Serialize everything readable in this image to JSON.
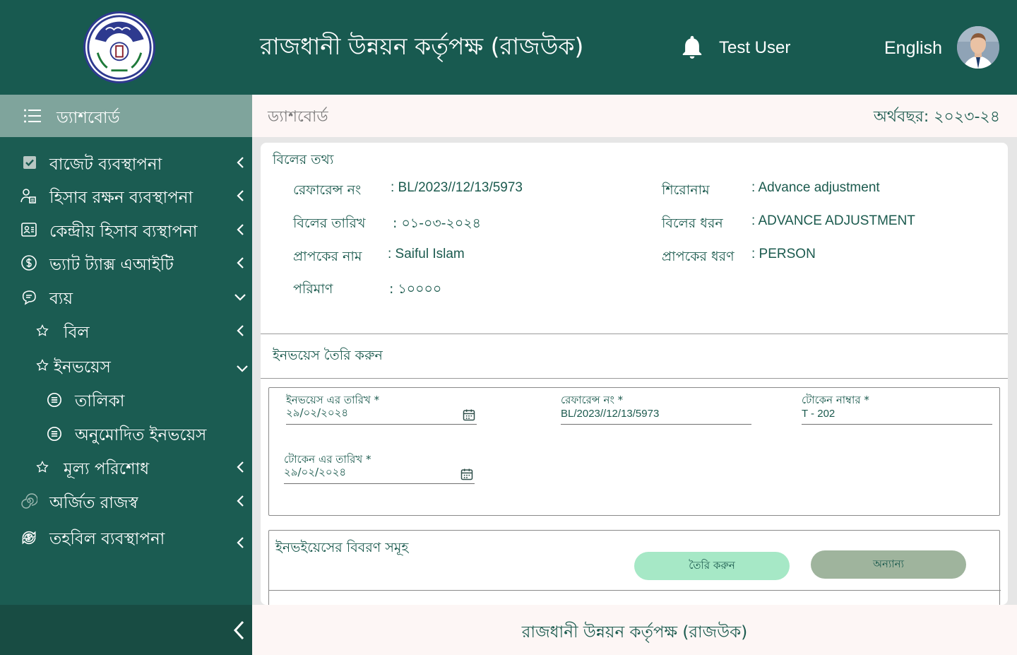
{
  "header": {
    "title": "রাজধানী উন্নয়ন কর্তৃপক্ষ (রাজউক)",
    "user_name": "Test User",
    "language": "English"
  },
  "sidebar": {
    "top_label": "ড্যাশবোর্ড",
    "items": [
      {
        "label": "বাজেট ব্যবস্থাপনা",
        "icon": "checkbox-icon"
      },
      {
        "label": "হিসাব রক্ষন ব্যবস্থাপনা",
        "icon": "user-accounting-icon"
      },
      {
        "label": "কেন্দ্রীয় হিসাব ব্যস্থাপনা",
        "icon": "central-account-icon"
      },
      {
        "label": "ভ্যাট ট্যাক্স এআইটি",
        "icon": "dollar-circle-icon"
      },
      {
        "label": "ব্যয়",
        "icon": "expense-icon"
      },
      {
        "label": "বিল",
        "icon": "star-icon"
      },
      {
        "label": "ইনভয়েস",
        "icon": "star-icon"
      },
      {
        "label": "তালিকা",
        "icon": "list-circle-icon"
      },
      {
        "label": "অনুমোদিত ইনভয়েস",
        "icon": "list-circle-icon"
      },
      {
        "label": "মূল্য পরিশোধ",
        "icon": "star-icon"
      },
      {
        "label": "অর্জিত রাজস্ব",
        "icon": "spiral-icon"
      },
      {
        "label": "তহবিল ব্যবস্থাপনা",
        "icon": "fund-exchange-icon"
      }
    ]
  },
  "content": {
    "breadcrumb": "ড্যাশবোর্ড",
    "fiscal_year": "অর্থবছর: ২০২৩-২৪"
  },
  "bill_info": {
    "title": "বিলের তথ্য",
    "ref_label": "রেফারেন্স নং",
    "ref_value": ": BL/2023//12/13/5973",
    "heading_label": "শিরোনাম",
    "heading_value": ": Advance adjustment",
    "date_label": "বিলের তারিখ",
    "date_value": ": ০১-০৩-২০২৪",
    "type_label": "বিলের ধরন",
    "type_value": ": ADVANCE ADJUSTMENT",
    "payee_label": "প্রাপকের নাম",
    "payee_value": ": Saiful Islam",
    "payee_type_label": "প্রাপকের ধরণ",
    "payee_type_value": ": PERSON",
    "amount_label": "পরিমাণ",
    "amount_value": ":  ১০০০০"
  },
  "invoice_form": {
    "title": "ইনভয়েস তৈরি করুন",
    "invoice_date_label": "ইনভয়েস এর তারিখ *",
    "invoice_date_value": "২৯/০২/২০২৪",
    "ref_label": "রেফারেন্স নং *",
    "ref_value": "BL/2023//12/13/5973",
    "token_label": "টোকেন নাম্বার *",
    "token_value": "T - 202",
    "token_date_label": "টোকেন এর তারিখ *",
    "token_date_value": "২৯/০২/২০২৪"
  },
  "invoice_details": {
    "title": "ইনভইয়েসের বিবরণ সমূহ",
    "create_button": "তৈরি করুন",
    "other_button": "অন্যান্য"
  },
  "footer": {
    "text": "রাজধানী উন্নয়ন কর্তৃপক্ষ (রাজউক)"
  },
  "colors": {
    "header_bg": "#185a50",
    "sidebar_bg": "#1b5c52",
    "sidebar_active": "#7fa49c",
    "accent_text": "#1b5a4e",
    "create_button": "#a6e8c6",
    "other_button": "#9fb49d"
  }
}
